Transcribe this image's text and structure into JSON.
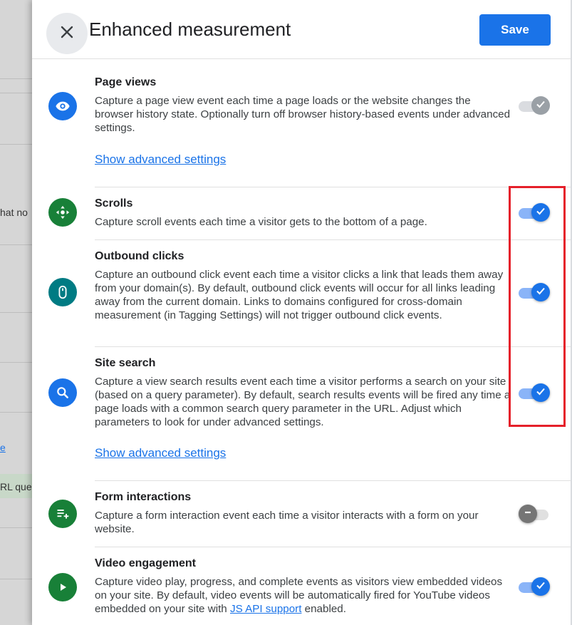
{
  "background": {
    "text_fragment": "hat no",
    "link_fragment": "e",
    "chip_fragment": "RL quer"
  },
  "header": {
    "title": "Enhanced measurement",
    "save_label": "Save",
    "close_icon": "close-icon"
  },
  "sections": [
    {
      "key": "page_views",
      "title": "Page views",
      "description": "Capture a page view event each time a page loads or the website changes the browser history state. Optionally turn off browser history-based events under advanced settings.",
      "advanced_link": "Show advanced settings",
      "icon": "eye-icon",
      "icon_color": "#1a73e8",
      "toggle_state": "on-disabled"
    },
    {
      "key": "scrolls",
      "title": "Scrolls",
      "description": "Capture scroll events each time a visitor gets to the bottom of a page.",
      "icon": "scroll-icon",
      "icon_color": "#188038",
      "toggle_state": "on"
    },
    {
      "key": "outbound_clicks",
      "title": "Outbound clicks",
      "description": "Capture an outbound click event each time a visitor clicks a link that leads them away from your domain(s). By default, outbound click events will occur for all links leading away from the current domain. Links to domains configured for cross-domain measurement (in Tagging Settings) will not trigger outbound click events.",
      "icon": "mouse-icon",
      "icon_color": "#007b83",
      "toggle_state": "on"
    },
    {
      "key": "site_search",
      "title": "Site search",
      "description": "Capture a view search results event each time a visitor performs a search on your site (based on a query parameter). By default, search results events will be fired any time a page loads with a common search query parameter in the URL. Adjust which parameters to look for under advanced settings.",
      "advanced_link": "Show advanced settings",
      "icon": "search-icon",
      "icon_color": "#1a73e8",
      "toggle_state": "on"
    },
    {
      "key": "form_interactions",
      "title": "Form interactions",
      "description": "Capture a form interaction event each time a visitor interacts with a form on your website.",
      "icon": "form-add-icon",
      "icon_color": "#188038",
      "toggle_state": "off"
    },
    {
      "key": "video_engagement",
      "title": "Video engagement",
      "description_before_link": "Capture video play, progress, and complete events as visitors view embedded videos on your site. By default, video events will be automatically fired for YouTube videos embedded on your site with ",
      "description_link": "JS API support",
      "description_after_link": " enabled.",
      "icon": "play-icon",
      "icon_color": "#188038",
      "toggle_state": "on"
    }
  ],
  "colors": {
    "accent": "#1a73e8",
    "highlight": "#e5202a"
  }
}
